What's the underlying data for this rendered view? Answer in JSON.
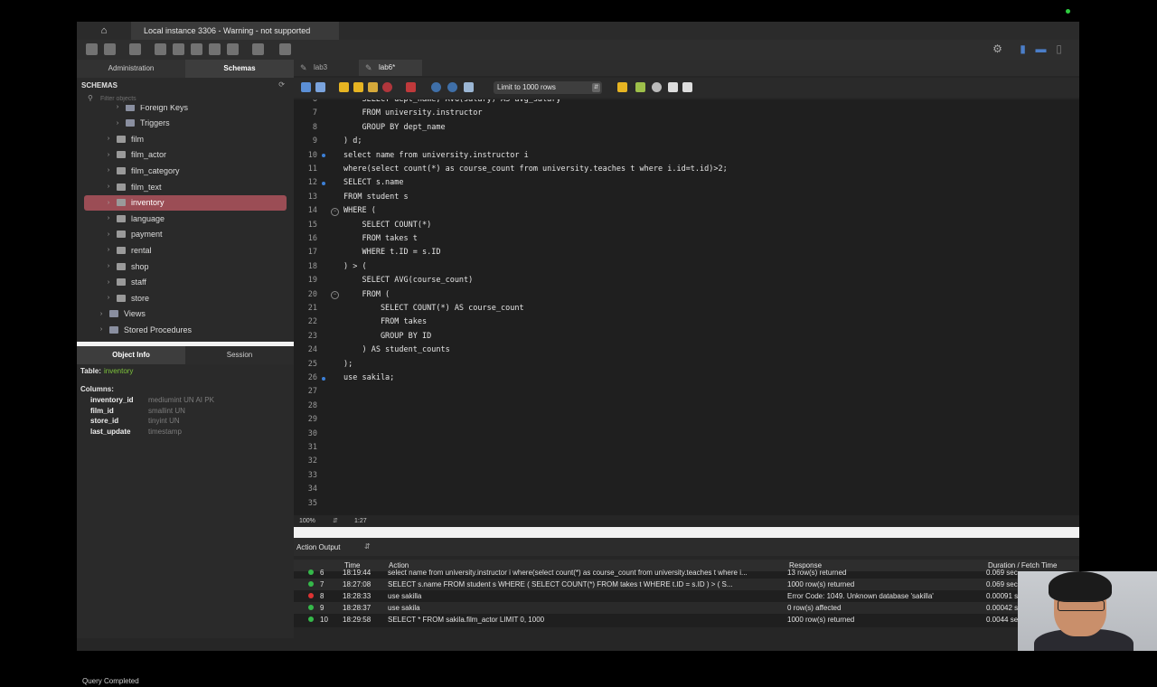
{
  "app": {
    "connection_tab": "Local instance 3306 - Warning - not supported"
  },
  "sidebar": {
    "tabs": [
      "Administration",
      "Schemas"
    ],
    "schemas_title": "SCHEMAS",
    "filter_placeholder": "Filter objects",
    "tree": [
      {
        "label": "Foreign Keys",
        "level": 2,
        "icon": "folder-icon"
      },
      {
        "label": "Triggers",
        "level": 2,
        "icon": "folder-icon"
      },
      {
        "label": "film",
        "level": 1,
        "icon": "table-icon"
      },
      {
        "label": "film_actor",
        "level": 1,
        "icon": "table-icon"
      },
      {
        "label": "film_category",
        "level": 1,
        "icon": "table-icon"
      },
      {
        "label": "film_text",
        "level": 1,
        "icon": "table-icon"
      },
      {
        "label": "inventory",
        "level": 1,
        "icon": "table-icon",
        "selected": true
      },
      {
        "label": "language",
        "level": 1,
        "icon": "table-icon"
      },
      {
        "label": "payment",
        "level": 1,
        "icon": "table-icon"
      },
      {
        "label": "rental",
        "level": 1,
        "icon": "table-icon"
      },
      {
        "label": "shop",
        "level": 1,
        "icon": "table-icon"
      },
      {
        "label": "staff",
        "level": 1,
        "icon": "table-icon"
      },
      {
        "label": "store",
        "level": 1,
        "icon": "table-icon"
      },
      {
        "label": "Views",
        "level": 0,
        "icon": "folder-icon"
      },
      {
        "label": "Stored Procedures",
        "level": 0,
        "icon": "folder-icon"
      }
    ],
    "info_tabs": [
      "Object Info",
      "Session"
    ],
    "object_info": {
      "table_label": "Table:",
      "table_name": "inventory",
      "columns_label": "Columns:",
      "columns": [
        {
          "name": "inventory_id",
          "type": "mediumint UN AI PK"
        },
        {
          "name": "film_id",
          "type": "smallint UN"
        },
        {
          "name": "store_id",
          "type": "tinyint UN"
        },
        {
          "name": "last_update",
          "type": "timestamp"
        }
      ]
    },
    "status": "Query Completed"
  },
  "editor": {
    "tabs": [
      {
        "label": "lab3",
        "active": false
      },
      {
        "label": "lab6*",
        "active": true
      }
    ],
    "limit_select": "Limit to 1000 rows",
    "lines": [
      {
        "n": "6",
        "text": "    SELECT dept_name, AVG(salary) AS avg_salary",
        "mark": false,
        "fold": false
      },
      {
        "n": "7",
        "text": "    FROM university.instructor",
        "mark": false,
        "fold": false
      },
      {
        "n": "8",
        "text": "    GROUP BY dept_name",
        "mark": false,
        "fold": false
      },
      {
        "n": "9",
        "text": ") d;",
        "mark": false,
        "fold": false
      },
      {
        "n": "10",
        "text": "select name from university.instructor i",
        "mark": true,
        "fold": false
      },
      {
        "n": "11",
        "text": "where(select count(*) as course_count from university.teaches t where i.id=t.id)>2;",
        "mark": false,
        "fold": false
      },
      {
        "n": "12",
        "text": "SELECT s.name",
        "mark": true,
        "fold": false
      },
      {
        "n": "13",
        "text": "FROM student s",
        "mark": false,
        "fold": false
      },
      {
        "n": "14",
        "text": "WHERE (",
        "mark": false,
        "fold": true
      },
      {
        "n": "15",
        "text": "    SELECT COUNT(*)",
        "mark": false,
        "fold": false
      },
      {
        "n": "16",
        "text": "    FROM takes t",
        "mark": false,
        "fold": false
      },
      {
        "n": "17",
        "text": "    WHERE t.ID = s.ID",
        "mark": false,
        "fold": false
      },
      {
        "n": "18",
        "text": ") > (",
        "mark": false,
        "fold": false
      },
      {
        "n": "19",
        "text": "    SELECT AVG(course_count)",
        "mark": false,
        "fold": false
      },
      {
        "n": "20",
        "text": "    FROM (",
        "mark": false,
        "fold": true
      },
      {
        "n": "21",
        "text": "        SELECT COUNT(*) AS course_count",
        "mark": false,
        "fold": false
      },
      {
        "n": "22",
        "text": "        FROM takes",
        "mark": false,
        "fold": false
      },
      {
        "n": "23",
        "text": "        GROUP BY ID",
        "mark": false,
        "fold": false
      },
      {
        "n": "24",
        "text": "    ) AS student_counts",
        "mark": false,
        "fold": false
      },
      {
        "n": "25",
        "text": ");",
        "mark": false,
        "fold": false
      },
      {
        "n": "26",
        "text": "use sakila;",
        "mark": true,
        "fold": false
      },
      {
        "n": "27",
        "text": "",
        "mark": false,
        "fold": false
      },
      {
        "n": "28",
        "text": "",
        "mark": false,
        "fold": false
      },
      {
        "n": "29",
        "text": "",
        "mark": false,
        "fold": false
      },
      {
        "n": "30",
        "text": "",
        "mark": false,
        "fold": false
      },
      {
        "n": "31",
        "text": "",
        "mark": false,
        "fold": false
      },
      {
        "n": "32",
        "text": "",
        "mark": false,
        "fold": false
      },
      {
        "n": "33",
        "text": "",
        "mark": false,
        "fold": false
      },
      {
        "n": "34",
        "text": "",
        "mark": false,
        "fold": false
      },
      {
        "n": "35",
        "text": "",
        "mark": false,
        "fold": false
      }
    ],
    "zoom": "100%",
    "cursor_pos": "1:27"
  },
  "output": {
    "title": "Action Output",
    "headers": [
      "Time",
      "Action",
      "Response",
      "Duration / Fetch Time"
    ],
    "rows": [
      {
        "num": "6",
        "status": "ok",
        "time": "18:19:44",
        "action": "select name from university.instructor i where(select count(*) as course_count from university.teaches t where i...",
        "response": "13 row(s) returned",
        "duration": "0.069 sec"
      },
      {
        "num": "7",
        "status": "ok",
        "time": "18:27:08",
        "action": "SELECT s.name FROM student s WHERE (     SELECT COUNT(*)     FROM takes t     WHERE t.ID = s.ID ) > (     S...",
        "response": "1000 row(s) returned",
        "duration": "0.069 sec"
      },
      {
        "num": "8",
        "status": "err",
        "time": "18:28:33",
        "action": "use sakilla",
        "response": "Error Code: 1049. Unknown database 'sakilla'",
        "duration": "0.00091 sec"
      },
      {
        "num": "9",
        "status": "ok",
        "time": "18:28:37",
        "action": "use sakila",
        "response": "0 row(s) affected",
        "duration": "0.00042 sec"
      },
      {
        "num": "10",
        "status": "ok",
        "time": "18:29:58",
        "action": "SELECT * FROM sakila.film_actor LIMIT 0, 1000",
        "response": "1000 row(s) returned",
        "duration": "0.0044 sec"
      }
    ]
  },
  "colors": {
    "selection": "#9b4d55",
    "ok": "#35b94a",
    "error": "#dd3333",
    "marker": "#3c7fd6"
  }
}
